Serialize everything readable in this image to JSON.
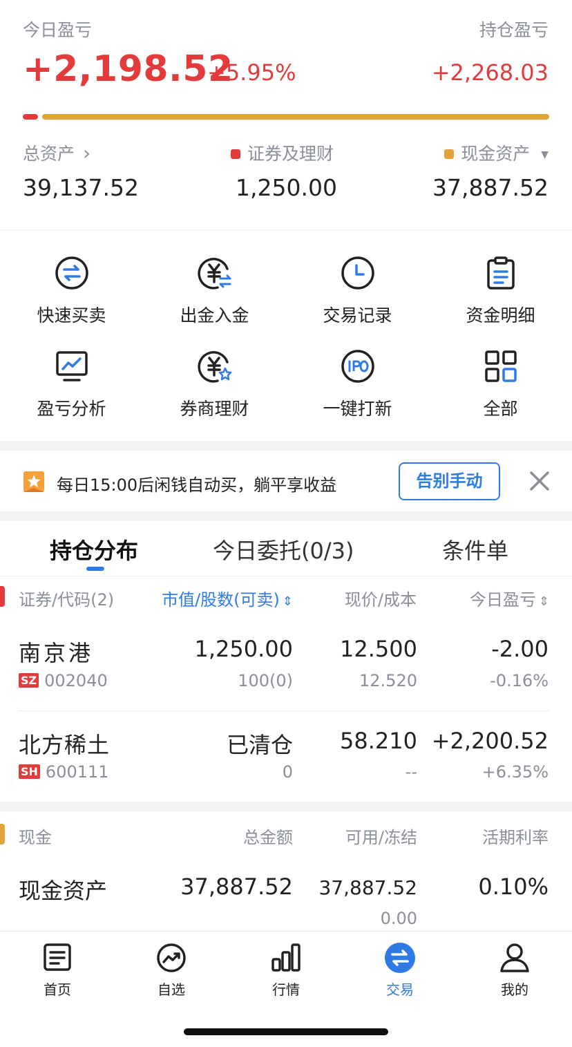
{
  "summary": {
    "today_pl_label": "今日盈亏",
    "today_pl_value": "+2,198.52",
    "today_pl_pct": "+5.95%",
    "holding_pl_label": "持仓盈亏",
    "holding_pl_value": "+2,268.03",
    "total_assets_label": "总资产",
    "total_assets_chevron": "›",
    "total_assets_value": "39,137.52",
    "securities_label": "证券及理财",
    "securities_value": "1,250.00",
    "cash_label": "现金资产",
    "cash_caret": "▼",
    "cash_value": "37,887.52",
    "securities_share": 0.032,
    "colors": {
      "red": "#e33b3b",
      "gold": "#e0a43a"
    }
  },
  "grid": [
    {
      "label": "快速买卖",
      "icon": "swap-circle-icon"
    },
    {
      "label": "出金入金",
      "icon": "yuan-transfer-icon"
    },
    {
      "label": "交易记录",
      "icon": "clock-icon"
    },
    {
      "label": "资金明细",
      "icon": "clipboard-icon"
    },
    {
      "label": "盈亏分析",
      "icon": "monitor-chart-icon"
    },
    {
      "label": "券商理财",
      "icon": "yuan-star-icon"
    },
    {
      "label": "一键打新",
      "icon": "ipo-icon"
    },
    {
      "label": "全部",
      "icon": "grid-icon"
    }
  ],
  "promo": {
    "text": "每日15:00后闲钱自动买，躺平享收益",
    "button": "告别手动",
    "close": "✕"
  },
  "tabs": [
    {
      "label": "持仓分布",
      "active": true
    },
    {
      "label": "今日委托(0/3)",
      "active": false
    },
    {
      "label": "条件单",
      "active": false
    }
  ],
  "table": {
    "headers": {
      "security": "证券/代码(2)",
      "market_value": "市值/股数(可卖)",
      "market_value_sort": "⇕",
      "price": "现价/成本",
      "today_pl": "今日盈亏",
      "today_pl_sort": "⇕"
    },
    "rows": [
      {
        "name": "南京港",
        "market": "SZ",
        "code": "002040",
        "value": "1,250.00",
        "shares": "100(0)",
        "price": "12.500",
        "cost": "12.520",
        "pl": "-2.00",
        "pl_pct": "-0.16%"
      },
      {
        "name": "北方稀土",
        "market": "SH",
        "code": "600111",
        "value": "已清仓",
        "shares": "0",
        "price": "58.210",
        "cost": "--",
        "pl": "+2,200.52",
        "pl_pct": "+6.35%"
      }
    ]
  },
  "cash": {
    "headers": {
      "name": "现金",
      "total": "总金额",
      "avail": "可用/冻结",
      "rate": "活期利率"
    },
    "row": {
      "name": "现金资产",
      "total": "37,887.52",
      "available": "37,887.52",
      "frozen": "0.00",
      "rate": "0.10%"
    }
  },
  "nav": [
    {
      "label": "首页",
      "icon": "home-doc-icon",
      "active": false
    },
    {
      "label": "自选",
      "icon": "trend-circle-icon",
      "active": false
    },
    {
      "label": "行情",
      "icon": "bar-chart-icon",
      "active": false
    },
    {
      "label": "交易",
      "icon": "swap-circle-icon",
      "active": true
    },
    {
      "label": "我的",
      "icon": "person-icon",
      "active": false
    }
  ]
}
